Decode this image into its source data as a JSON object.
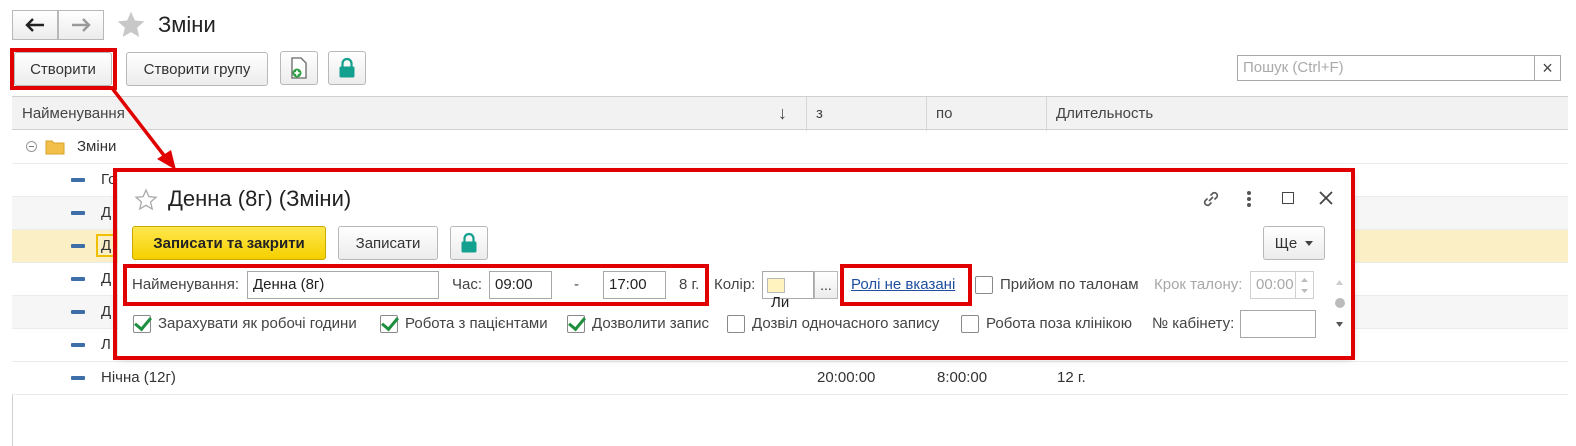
{
  "window": {
    "title": "Зміни"
  },
  "toolbar": {
    "create_label": "Створити",
    "create_group_label": "Створити групу",
    "search_placeholder": "Пошук (Ctrl+F)",
    "search_clear": "×"
  },
  "table": {
    "columns": [
      "Найменування",
      "з",
      "по",
      "Длительность"
    ],
    "sort_indicator": "↓",
    "group_label": "Зміни",
    "rows": [
      {
        "name": "Го",
        "from": "",
        "to": "",
        "duration": ""
      },
      {
        "name": "Д",
        "from": "",
        "to": "",
        "duration": ""
      },
      {
        "name": "Д",
        "from": "",
        "to": "",
        "duration": ""
      },
      {
        "name": "Д",
        "from": "",
        "to": "",
        "duration": ""
      },
      {
        "name": "Д",
        "from": "",
        "to": "",
        "duration": ""
      },
      {
        "name": "Л",
        "from": "",
        "to": "",
        "duration": ""
      },
      {
        "name": "Нічна (12г)",
        "from": "20:00:00",
        "to": "8:00:00",
        "duration": "12 г."
      }
    ]
  },
  "dialog": {
    "title": "Денна (8г) (Зміни)",
    "save_close_label": "Записати та закрити",
    "save_label": "Записати",
    "more_label": "Ще",
    "name_label": "Найменування:",
    "name_value": "Денна (8г)",
    "time_label": "Час:",
    "time_from": "09:00",
    "time_sep": "-",
    "time_to": "17:00",
    "hours": "8 г.",
    "color_label": "Колір:",
    "color_value": "Ли",
    "color_btn": "...",
    "roles_link": "Ролі не вказані",
    "tickets_label": "Прийом по талонам",
    "ticket_step_label": "Крок талону:",
    "ticket_step_value": "00:00",
    "checkboxes": [
      {
        "label": "Зарахувати як робочі години",
        "checked": true
      },
      {
        "label": "Робота з пацієнтами",
        "checked": true
      },
      {
        "label": "Дозволити запис",
        "checked": true
      },
      {
        "label": "Дозвіл одночасного запису",
        "checked": false
      },
      {
        "label": "Робота поза клінікою",
        "checked": false
      }
    ],
    "cabinet_label": "№ кабінету:",
    "cabinet_value": ""
  },
  "colors": {
    "highlight": "#e00000",
    "primary_button": "#f5d40a",
    "link": "#1f4ea0",
    "accent": "#14a08e"
  }
}
